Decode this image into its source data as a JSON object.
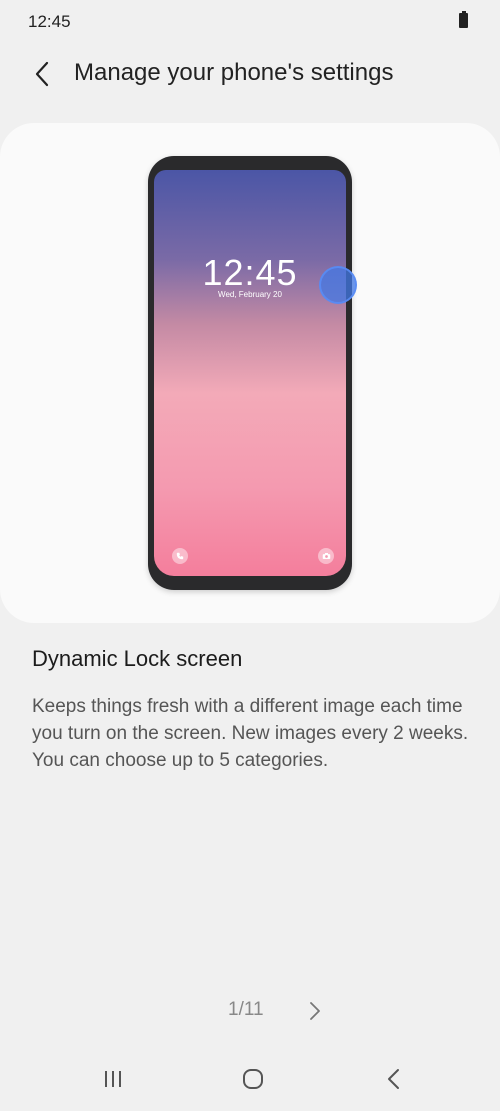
{
  "status_bar": {
    "time": "12:45"
  },
  "header": {
    "title": "Manage your phone's settings"
  },
  "preview": {
    "lock_time": "12:45",
    "lock_date": "Wed, February 20"
  },
  "feature": {
    "title": "Dynamic Lock screen",
    "description": "Keeps things fresh with a different image each time you turn on the screen. New images every 2 weeks. You can choose up to 5 categories."
  },
  "pager": {
    "indicator": "1/11"
  },
  "icons": {
    "back": "chevron-left-icon",
    "next": "chevron-right-icon",
    "battery": "battery-icon",
    "recents": "recents-icon",
    "home": "home-icon",
    "nav_back": "back-icon",
    "phone": "phone-icon",
    "camera": "camera-icon"
  },
  "colors": {
    "background": "#f0f0f0",
    "card": "#fafafa",
    "touch_indicator": "#4278e6"
  }
}
